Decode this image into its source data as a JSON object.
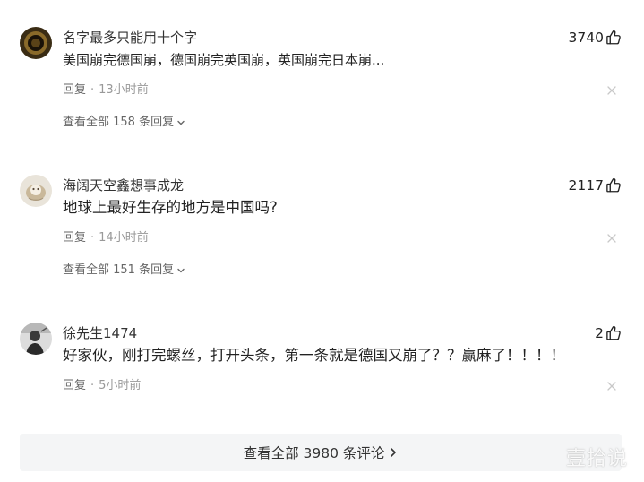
{
  "comments": [
    {
      "username": "名字最多只能用十个字",
      "likes": "3740",
      "content": "美国崩完德国崩，德国崩完英国崩，英国崩完日本崩...",
      "reply_label": "回复",
      "separator": "·",
      "time": "13小时前",
      "view_replies": "查看全部 158 条回复"
    },
    {
      "username": "海阔天空鑫想事成龙",
      "likes": "2117",
      "content": "地球上最好生存的地方是中国吗?",
      "reply_label": "回复",
      "separator": "·",
      "time": "14小时前",
      "view_replies": "查看全部 151 条回复"
    },
    {
      "username": "徐先生1474",
      "likes": "2",
      "content": "好家伙，刚打完螺丝，打开头条，第一条就是德国又崩了？？赢麻了！！！！",
      "reply_label": "回复",
      "separator": "·",
      "time": "5小时前"
    }
  ],
  "view_all_label": "查看全部 3980 条评论",
  "watermark": "壹拾说",
  "icons": {
    "like": "thumbs-up-outline-icon",
    "close": "close-x-icon",
    "expand": "chevron-down-icon",
    "more": "chevron-right-icon"
  },
  "colors": {
    "meta_text": "#999999",
    "button_bg": "#f4f5f6"
  }
}
